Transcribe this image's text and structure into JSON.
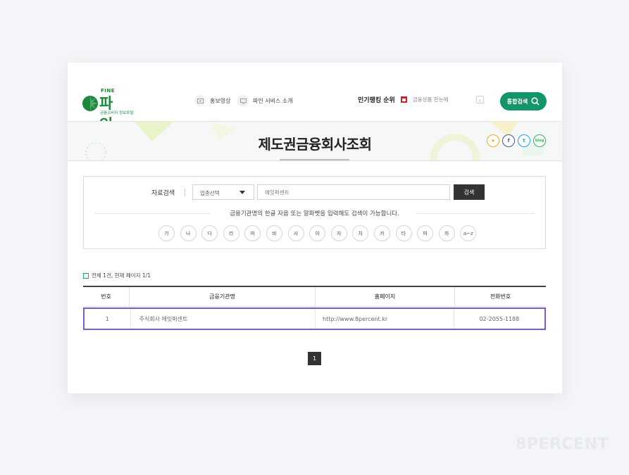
{
  "header": {
    "logo": {
      "fine": "FINE",
      "name": "파 인",
      "subtitle": "금융소비자 정보포털"
    },
    "nav": [
      {
        "label": "홍보영상",
        "icon": "play-icon"
      },
      {
        "label": "파인 서비스 소개",
        "icon": "monitor-icon"
      }
    ],
    "ranking": {
      "title": "인기랭킹 순위",
      "item": "금융상품 한눈에"
    },
    "total_search_label": "통합검색",
    "colors": {
      "brand_green": "#13956a",
      "logo_green": "#1a8a3a"
    }
  },
  "banner": {
    "title": "제도권금융회사조회",
    "social": [
      {
        "icon": "star-icon",
        "text": "★",
        "color": "#f2a81d"
      },
      {
        "icon": "facebook-icon",
        "text": "f",
        "color": "#3b5998"
      },
      {
        "icon": "twitter-icon",
        "text": "t",
        "color": "#1da1f2"
      },
      {
        "icon": "blog-icon",
        "text": "blog",
        "color": "#2eb34a"
      }
    ]
  },
  "search": {
    "label": "자료검색",
    "select_value": "업종선택",
    "input_value": "에잇퍼센트",
    "button_label": "검색",
    "hint": "금융기관명의 한글 자음 또는 알파벳을 입력해도 검색이 가능합니다.",
    "letters": [
      "가",
      "나",
      "다",
      "라",
      "마",
      "바",
      "사",
      "아",
      "자",
      "차",
      "카",
      "타",
      "파",
      "하",
      "a~z"
    ]
  },
  "results": {
    "info": "전체 1건, 현재 페이지 1/1",
    "columns": [
      "번호",
      "금융기관명",
      "홈페이지",
      "전화번호"
    ],
    "rows": [
      {
        "no": "1",
        "name": "주식회사 에잇퍼센트",
        "homepage": "http://www.8percent.kr",
        "phone": "02-2055-1188"
      }
    ],
    "page": "1",
    "highlight_color": "#7b5ad6"
  },
  "watermark": "8PERCENT"
}
